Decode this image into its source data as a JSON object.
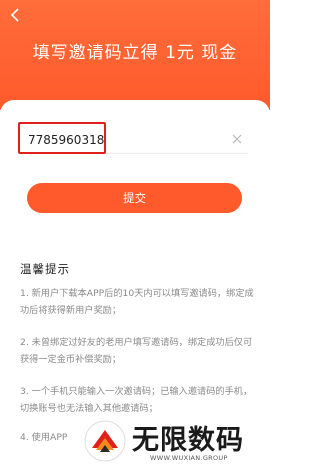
{
  "header": {
    "back_icon": "chevron-left-icon",
    "title": "填写邀请码立得 1元 现金",
    "color": "#ff5a2c"
  },
  "form": {
    "code_value": "7785960318",
    "clear_icon": "close-icon",
    "submit_label": "提交",
    "highlight_color": "#e0211b"
  },
  "tips": {
    "heading": "温馨提示",
    "items": [
      "1. 新用户下载本APP后的10天内可以填写邀请码，绑定成功后将获得新用户奖励；",
      "2. 未曾绑定过好友的老用户填写邀请码，绑定成功后仅可获得一定金币补偿奖励；",
      "3. 一个手机只能输入一次邀请码；已输入邀请码的手机，切换账号也无法输入其他邀请码；",
      "4. 使用APP"
    ]
  },
  "watermark": {
    "text": "无限数码",
    "url": "WWW.WUXIAN.GROUP"
  }
}
